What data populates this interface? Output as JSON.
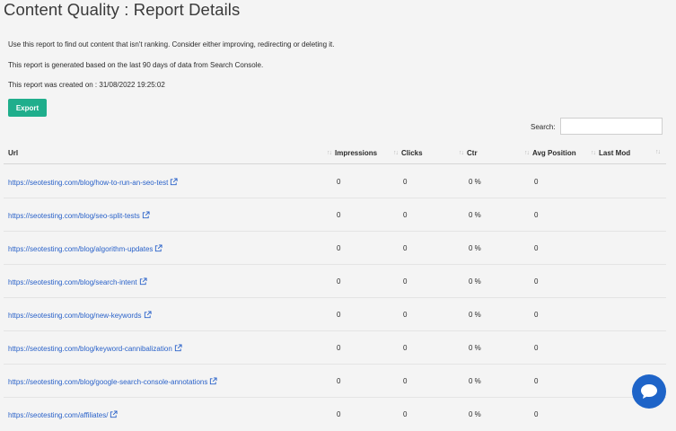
{
  "title": "Content Quality : Report Details",
  "descriptions": [
    "Use this report to find out content that isn't ranking. Consider either improving, redirecting or deleting it.",
    "This report is generated based on the last 90 days of data from Search Console.",
    "This report was created on : 31/08/2022 19:25:02"
  ],
  "export_label": "Export",
  "search": {
    "label": "Search:",
    "value": "",
    "placeholder": ""
  },
  "table": {
    "columns": [
      "Url",
      "Impressions",
      "Clicks",
      "Ctr",
      "Avg Position",
      "Last Mod"
    ],
    "rows": [
      {
        "url": "https://seotesting.com/blog/how-to-run-an-seo-test",
        "impressions": "0",
        "clicks": "0",
        "ctr": "0 %",
        "avg_position": "0",
        "last_mod": ""
      },
      {
        "url": "https://seotesting.com/blog/seo-split-tests",
        "impressions": "0",
        "clicks": "0",
        "ctr": "0 %",
        "avg_position": "0",
        "last_mod": ""
      },
      {
        "url": "https://seotesting.com/blog/algorithm-updates",
        "impressions": "0",
        "clicks": "0",
        "ctr": "0 %",
        "avg_position": "0",
        "last_mod": ""
      },
      {
        "url": "https://seotesting.com/blog/search-intent",
        "impressions": "0",
        "clicks": "0",
        "ctr": "0 %",
        "avg_position": "0",
        "last_mod": ""
      },
      {
        "url": "https://seotesting.com/blog/new-keywords",
        "impressions": "0",
        "clicks": "0",
        "ctr": "0 %",
        "avg_position": "0",
        "last_mod": ""
      },
      {
        "url": "https://seotesting.com/blog/keyword-cannibalization",
        "impressions": "0",
        "clicks": "0",
        "ctr": "0 %",
        "avg_position": "0",
        "last_mod": ""
      },
      {
        "url": "https://seotesting.com/blog/google-search-console-annotations",
        "impressions": "0",
        "clicks": "0",
        "ctr": "0 %",
        "avg_position": "0",
        "last_mod": ""
      },
      {
        "url": "https://seotesting.com/affiliates/",
        "impressions": "0",
        "clicks": "0",
        "ctr": "0 %",
        "avg_position": "0",
        "last_mod": ""
      }
    ]
  },
  "icons": {
    "row_link": "external-link-icon",
    "chat": "chat-bubble-icon",
    "sort": "sort-arrows-icon"
  },
  "colors": {
    "accent": "#1fae8c",
    "link": "#2a62c9",
    "chat": "#1e64c8"
  }
}
